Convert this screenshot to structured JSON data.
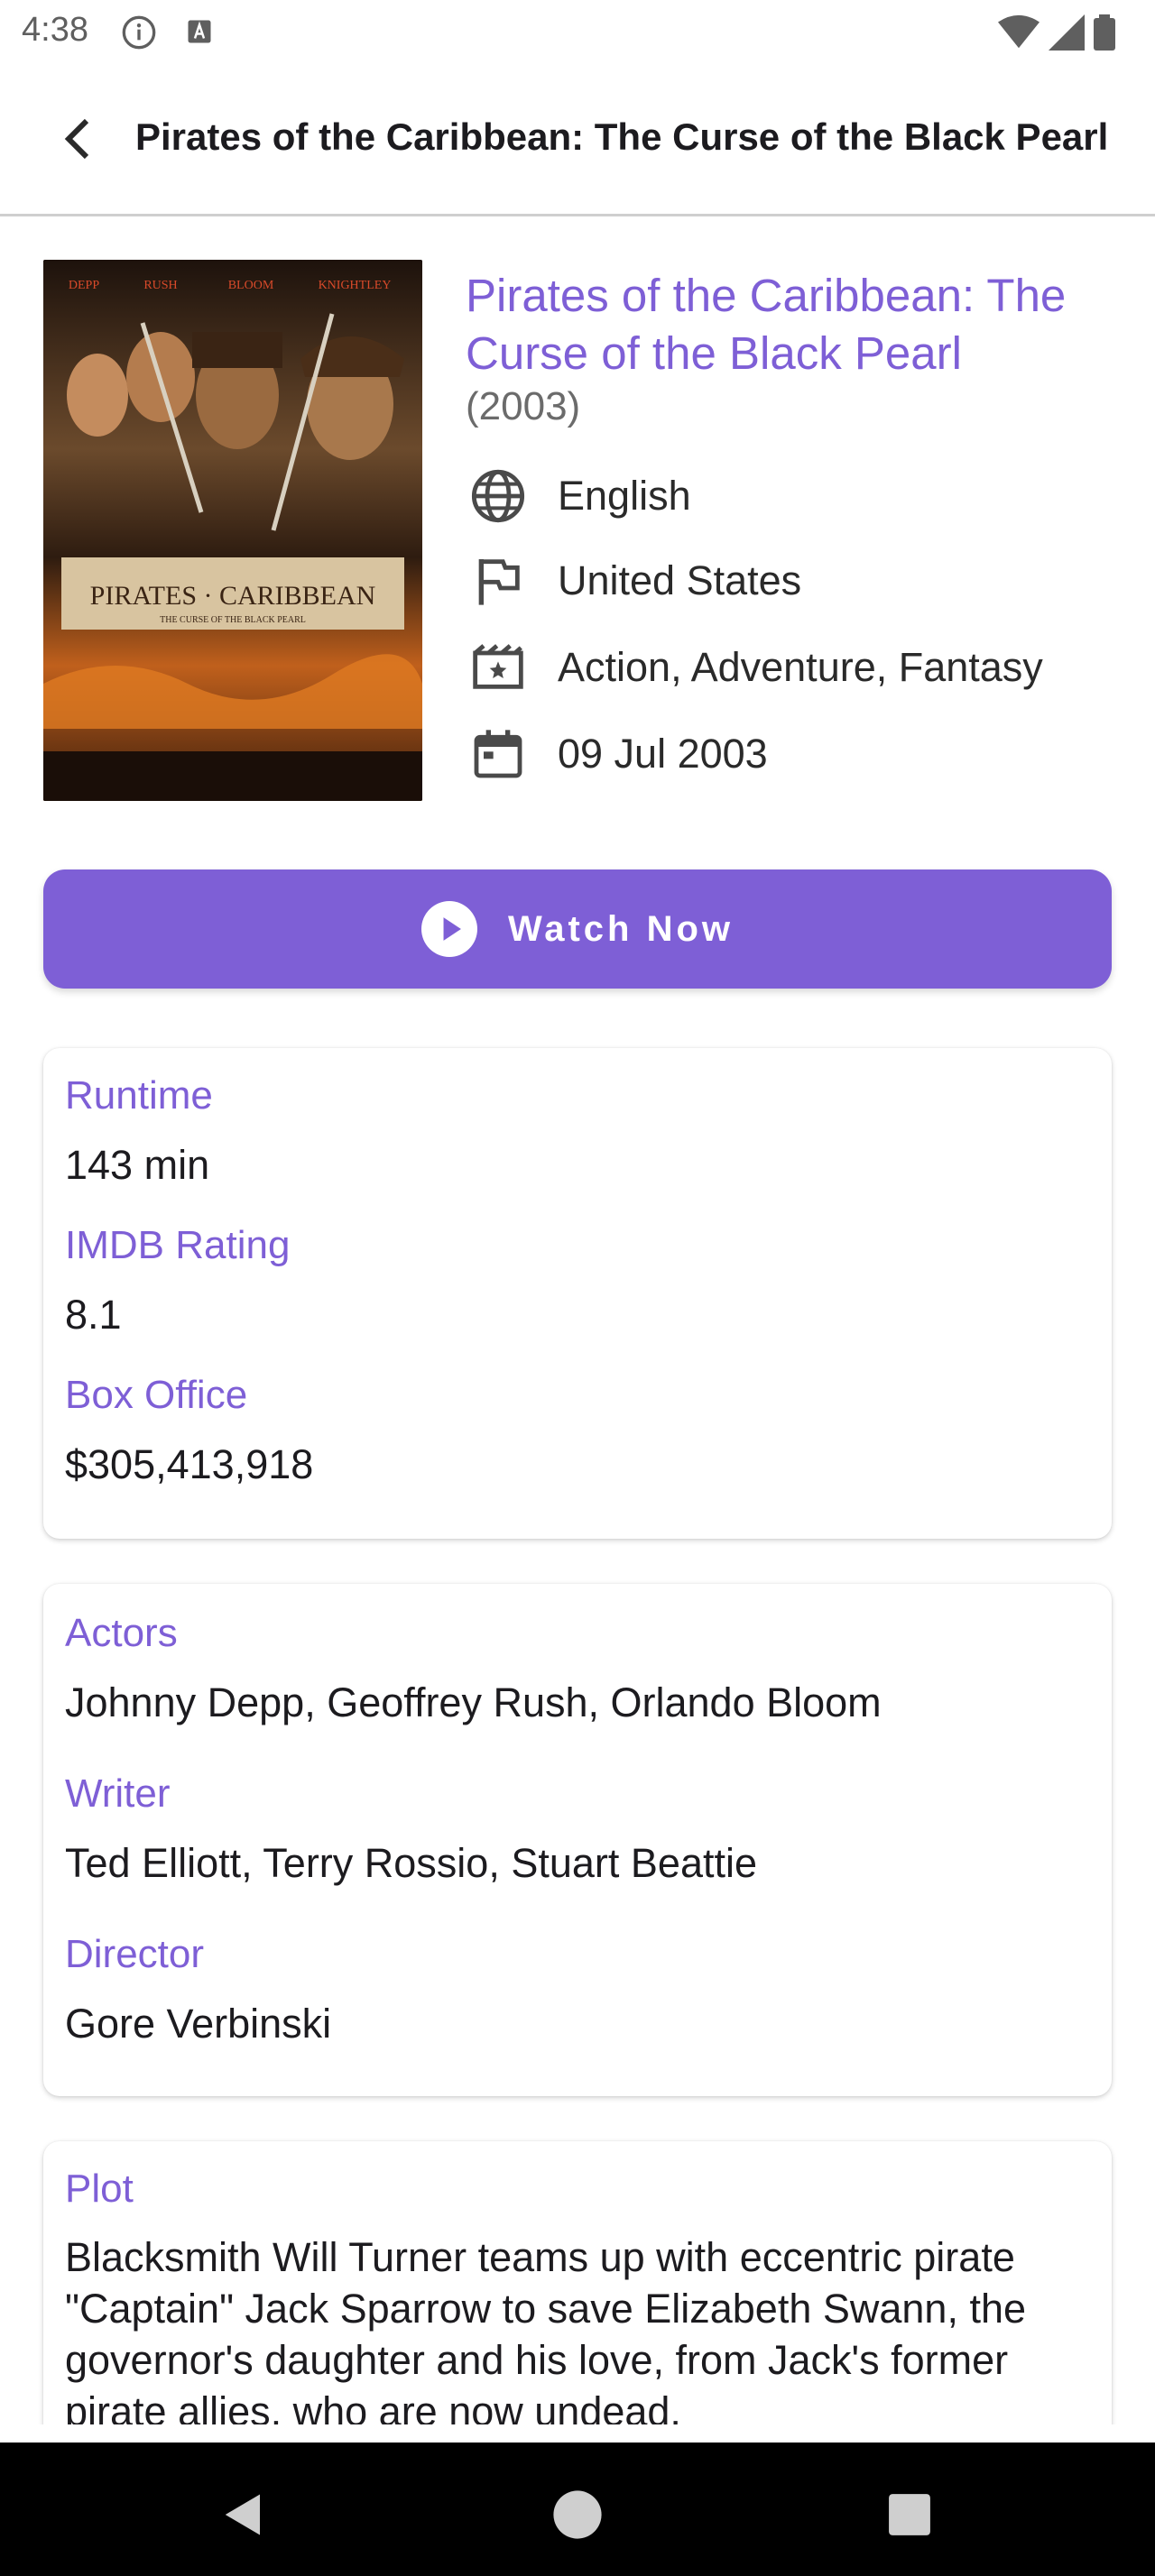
{
  "status_bar": {
    "time": "4:38"
  },
  "app_bar": {
    "title": "Pirates of the Caribbean: The Curse of the Black Pearl"
  },
  "movie": {
    "title": "Pirates of the Caribbean: The Curse of the Black Pearl",
    "year": "(2003)",
    "language": "English",
    "country": "United States",
    "genre": "Action, Adventure, Fantasy",
    "release_date": "09 Jul 2003",
    "poster": {
      "top_names": [
        "DEPP",
        "RUSH",
        "BLOOM",
        "KNIGHTLEY"
      ],
      "logo_text": "PIRATES CARIBBEAN",
      "tagline": "THE CURSE OF THE BLACK PEARL"
    }
  },
  "watch_button": {
    "label": "Watch Now"
  },
  "stats_card": {
    "runtime_label": "Runtime",
    "runtime_value": "143 min",
    "imdb_label": "IMDB Rating",
    "imdb_value": "8.1",
    "box_office_label": "Box Office",
    "box_office_value": "$305,413,918"
  },
  "credits_card": {
    "actors_label": "Actors",
    "actors_value": "Johnny Depp, Geoffrey Rush, Orlando Bloom",
    "writer_label": "Writer",
    "writer_value": "Ted Elliott, Terry Rossio, Stuart Beattie",
    "director_label": "Director",
    "director_value": "Gore Verbinski"
  },
  "plot_card": {
    "label": "Plot",
    "text": "Blacksmith Will Turner teams up with eccentric pirate \"Captain\" Jack Sparrow to save Elizabeth Swann, the governor's daughter and his love, from Jack's former pirate allies, who are now undead."
  },
  "colors": {
    "accent": "#7e5fd6",
    "nav_bar": "#000000"
  },
  "icons": {
    "language": "globe-icon",
    "country": "flag-icon",
    "genre": "movie-icon",
    "release": "calendar-icon"
  }
}
